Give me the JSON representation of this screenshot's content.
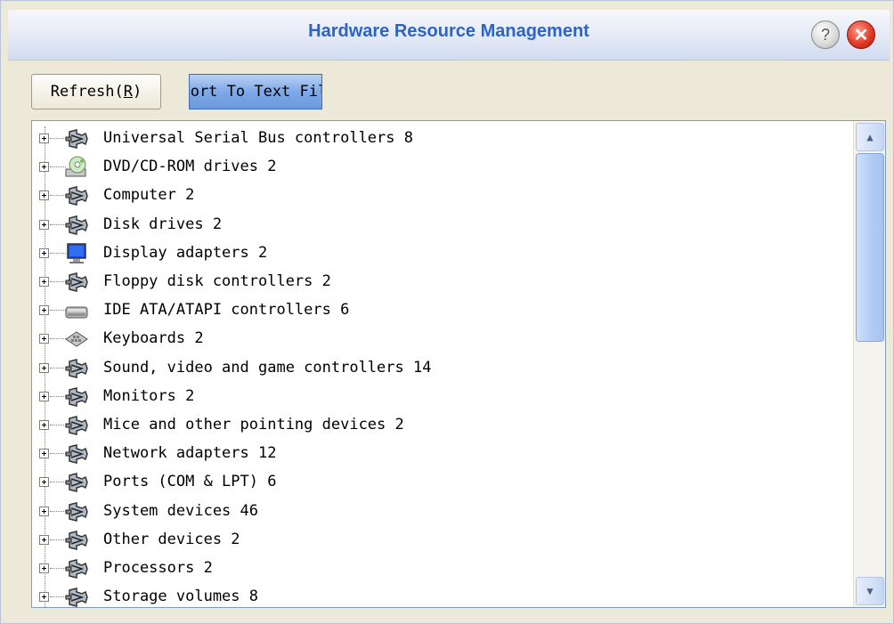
{
  "window": {
    "title": "Hardware Resource Management",
    "help_glyph": "?",
    "close_glyph": "✕"
  },
  "toolbar": {
    "refresh_label_prefix": "Refresh(",
    "refresh_hotkey": "R",
    "refresh_label_suffix": ")",
    "export_label": "Export To Text File"
  },
  "tree": {
    "items": [
      {
        "label": "Universal Serial Bus controllers 8",
        "icon": "usb-icon"
      },
      {
        "label": "DVD/CD-ROM drives 2",
        "icon": "cd-drive-icon"
      },
      {
        "label": "Computer 2",
        "icon": "usb-icon"
      },
      {
        "label": "Disk drives 2",
        "icon": "usb-icon"
      },
      {
        "label": "Display adapters 2",
        "icon": "monitor-icon"
      },
      {
        "label": "Floppy disk controllers 2",
        "icon": "usb-icon"
      },
      {
        "label": "IDE ATA/ATAPI controllers 6",
        "icon": "ide-controller-icon"
      },
      {
        "label": "Keyboards 2",
        "icon": "keyboard-icon"
      },
      {
        "label": "Sound, video and game controllers 14",
        "icon": "usb-icon"
      },
      {
        "label": "Monitors 2",
        "icon": "usb-icon"
      },
      {
        "label": "Mice and other pointing devices 2",
        "icon": "usb-icon"
      },
      {
        "label": "Network adapters 12",
        "icon": "usb-icon"
      },
      {
        "label": "Ports (COM & LPT) 6",
        "icon": "usb-icon"
      },
      {
        "label": "System devices 46",
        "icon": "usb-icon"
      },
      {
        "label": "Other devices 2",
        "icon": "usb-icon"
      },
      {
        "label": "Processors 2",
        "icon": "usb-icon"
      },
      {
        "label": "Storage volumes 8",
        "icon": "usb-icon"
      }
    ]
  },
  "scrollbar": {
    "up_glyph": "▲",
    "down_glyph": "▼"
  }
}
